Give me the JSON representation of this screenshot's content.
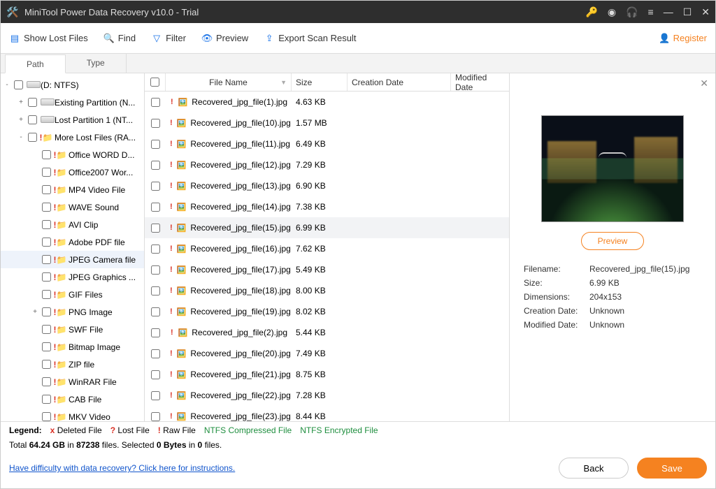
{
  "titlebar": {
    "title": "MiniTool Power Data Recovery v10.0 - Trial"
  },
  "toolbar": {
    "show_lost": "Show Lost Files",
    "find": "Find",
    "filter": "Filter",
    "preview": "Preview",
    "export": "Export Scan Result",
    "register": "Register"
  },
  "tabs": {
    "path": "Path",
    "type": "Type"
  },
  "tree": [
    {
      "indent": 0,
      "toggle": "-",
      "icon": "drive",
      "label": "(D: NTFS)"
    },
    {
      "indent": 1,
      "toggle": "+",
      "icon": "drive",
      "label": "Existing Partition (N..."
    },
    {
      "indent": 1,
      "toggle": "+",
      "icon": "drive",
      "label": "Lost Partition 1 (NT..."
    },
    {
      "indent": 1,
      "toggle": "-",
      "icon": "rawfolder",
      "label": "More Lost Files (RA..."
    },
    {
      "indent": 2,
      "toggle": "",
      "icon": "rawfolder",
      "label": "Office WORD D..."
    },
    {
      "indent": 2,
      "toggle": "",
      "icon": "rawfolder",
      "label": "Office2007 Wor..."
    },
    {
      "indent": 2,
      "toggle": "",
      "icon": "rawfolder",
      "label": "MP4 Video File"
    },
    {
      "indent": 2,
      "toggle": "",
      "icon": "rawfolder",
      "label": "WAVE Sound"
    },
    {
      "indent": 2,
      "toggle": "",
      "icon": "rawfolder",
      "label": "AVI Clip"
    },
    {
      "indent": 2,
      "toggle": "",
      "icon": "rawfolder",
      "label": "Adobe PDF file"
    },
    {
      "indent": 2,
      "toggle": "",
      "icon": "rawfolder",
      "label": "JPEG Camera file",
      "selected": true
    },
    {
      "indent": 2,
      "toggle": "",
      "icon": "rawfolder",
      "label": "JPEG Graphics ..."
    },
    {
      "indent": 2,
      "toggle": "",
      "icon": "rawfolder",
      "label": "GIF Files"
    },
    {
      "indent": 2,
      "toggle": "+",
      "icon": "rawfolder",
      "label": "PNG Image"
    },
    {
      "indent": 2,
      "toggle": "",
      "icon": "rawfolder",
      "label": "SWF File"
    },
    {
      "indent": 2,
      "toggle": "",
      "icon": "rawfolder",
      "label": "Bitmap Image"
    },
    {
      "indent": 2,
      "toggle": "",
      "icon": "rawfolder",
      "label": "ZIP file"
    },
    {
      "indent": 2,
      "toggle": "",
      "icon": "rawfolder",
      "label": "WinRAR File"
    },
    {
      "indent": 2,
      "toggle": "",
      "icon": "rawfolder",
      "label": "CAB File"
    },
    {
      "indent": 2,
      "toggle": "",
      "icon": "rawfolder",
      "label": "MKV Video"
    }
  ],
  "columns": {
    "name": "File Name",
    "size": "Size",
    "cdate": "Creation Date",
    "mdate": "Modified Date"
  },
  "files": [
    {
      "name": "Recovered_jpg_file(1).jpg",
      "size": "4.63 KB"
    },
    {
      "name": "Recovered_jpg_file(10).jpg",
      "size": "1.57 MB"
    },
    {
      "name": "Recovered_jpg_file(11).jpg",
      "size": "6.49 KB"
    },
    {
      "name": "Recovered_jpg_file(12).jpg",
      "size": "7.29 KB"
    },
    {
      "name": "Recovered_jpg_file(13).jpg",
      "size": "6.90 KB"
    },
    {
      "name": "Recovered_jpg_file(14).jpg",
      "size": "7.38 KB"
    },
    {
      "name": "Recovered_jpg_file(15).jpg",
      "size": "6.99 KB",
      "selected": true
    },
    {
      "name": "Recovered_jpg_file(16).jpg",
      "size": "7.62 KB"
    },
    {
      "name": "Recovered_jpg_file(17).jpg",
      "size": "5.49 KB"
    },
    {
      "name": "Recovered_jpg_file(18).jpg",
      "size": "8.00 KB"
    },
    {
      "name": "Recovered_jpg_file(19).jpg",
      "size": "8.02 KB"
    },
    {
      "name": "Recovered_jpg_file(2).jpg",
      "size": "5.44 KB"
    },
    {
      "name": "Recovered_jpg_file(20).jpg",
      "size": "7.49 KB"
    },
    {
      "name": "Recovered_jpg_file(21).jpg",
      "size": "8.75 KB"
    },
    {
      "name": "Recovered_jpg_file(22).jpg",
      "size": "7.28 KB"
    },
    {
      "name": "Recovered_jpg_file(23).jpg",
      "size": "8.44 KB"
    }
  ],
  "preview": {
    "button": "Preview",
    "filename_k": "Filename:",
    "filename_v": "Recovered_jpg_file(15).jpg",
    "size_k": "Size:",
    "size_v": "6.99 KB",
    "dim_k": "Dimensions:",
    "dim_v": "204x153",
    "cdate_k": "Creation Date:",
    "cdate_v": "Unknown",
    "mdate_k": "Modified Date:",
    "mdate_v": "Unknown"
  },
  "legend": {
    "label": "Legend:",
    "deleted_sym": "x",
    "deleted": "Deleted File",
    "lost_sym": "?",
    "lost": "Lost File",
    "raw_sym": "!",
    "raw": "Raw File",
    "ntfs_c": "NTFS Compressed File",
    "ntfs_e": "NTFS Encrypted File"
  },
  "stats": {
    "p1": "Total ",
    "total_size": "64.24 GB",
    "p2": " in ",
    "total_files": "87238",
    "p3": " files.   Selected ",
    "sel_bytes": "0 Bytes",
    "p4": " in ",
    "sel_files": "0",
    "p5": " files."
  },
  "bottom": {
    "help": "Have difficulty with data recovery? Click here for instructions.",
    "back": "Back",
    "save": "Save"
  }
}
